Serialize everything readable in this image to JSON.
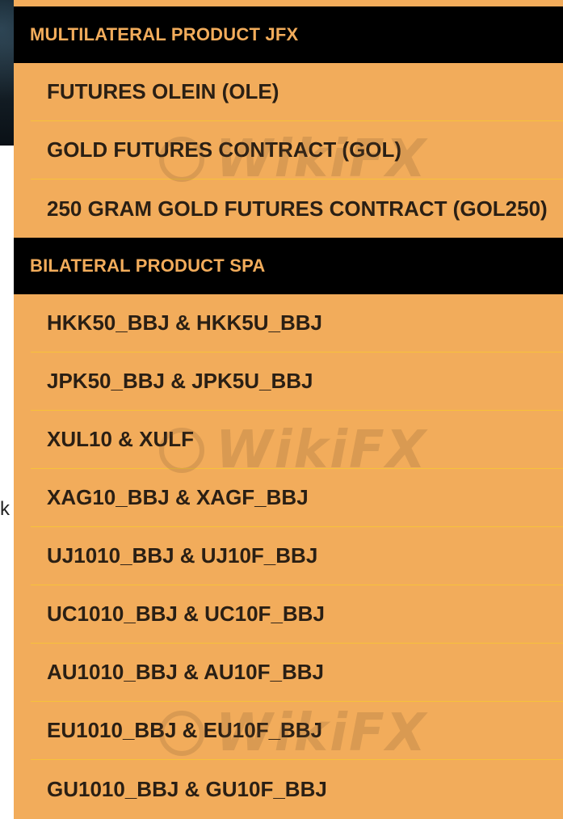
{
  "page_fragment_text": "k",
  "watermark": {
    "text": "WikiFX"
  },
  "sections": [
    {
      "header": "MULTILATERAL PRODUCT JFX",
      "items": [
        "FUTURES OLEIN (OLE)",
        "GOLD FUTURES CONTRACT (GOL)",
        "250 GRAM GOLD FUTURES CONTRACT (GOL250)"
      ]
    },
    {
      "header": "BILATERAL PRODUCT SPA",
      "items": [
        "HKK50_BBJ & HKK5U_BBJ",
        "JPK50_BBJ & JPK5U_BBJ",
        "XUL10 & XULF",
        "XAG10_BBJ & XAGF_BBJ",
        "UJ1010_BBJ & UJ10F_BBJ",
        "UC1010_BBJ & UC10F_BBJ",
        "AU1010_BBJ & AU10F_BBJ",
        "EU1010_BBJ & EU10F_BBJ",
        "GU1010_BBJ & GU10F_BBJ"
      ]
    }
  ],
  "colors": {
    "menu_background": "#f2ac5b",
    "header_background": "#000000",
    "header_text": "#f2ac5b",
    "item_text": "#2a1f14",
    "divider": "#f7c23a"
  }
}
